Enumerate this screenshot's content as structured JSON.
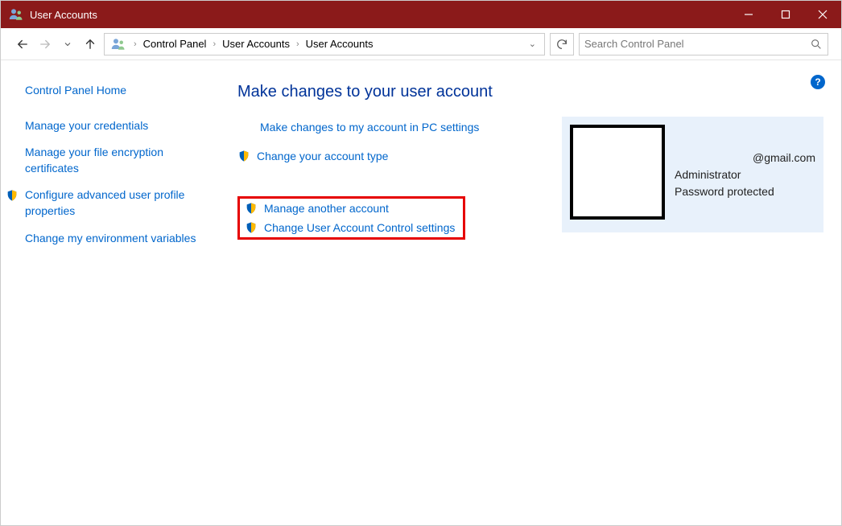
{
  "window": {
    "title": "User Accounts"
  },
  "breadcrumb": {
    "items": [
      "Control Panel",
      "User Accounts",
      "User Accounts"
    ]
  },
  "search": {
    "placeholder": "Search Control Panel"
  },
  "sidebar": {
    "home": "Control Panel Home",
    "items": [
      {
        "label": "Manage your credentials",
        "shield": false
      },
      {
        "label": "Manage your file encryption certificates",
        "shield": false
      },
      {
        "label": "Configure advanced user profile properties",
        "shield": true
      },
      {
        "label": "Change my environment variables",
        "shield": false
      }
    ]
  },
  "main": {
    "heading": "Make changes to your user account",
    "links": {
      "pc_settings": "Make changes to my account in PC settings",
      "change_type": "Change your account type",
      "manage_other": "Manage another account",
      "uac": "Change User Account Control settings"
    }
  },
  "account": {
    "email": "@gmail.com",
    "role": "Administrator",
    "protection": "Password protected"
  },
  "help": "?"
}
